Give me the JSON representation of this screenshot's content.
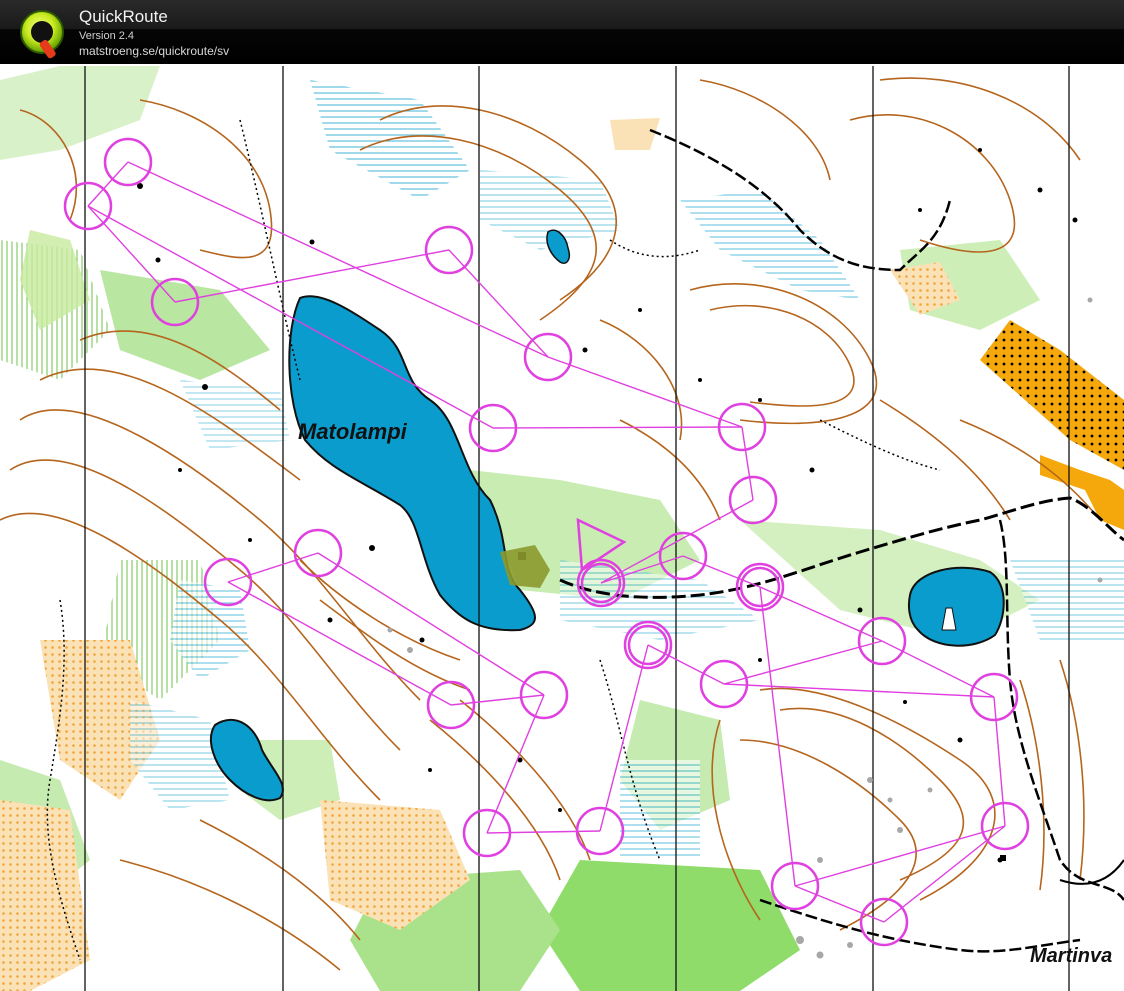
{
  "app": {
    "name": "QuickRoute",
    "version": "Version 2.4",
    "url": "matstroeng.se/quickroute/sv"
  },
  "map": {
    "labels": {
      "lake": "Matolampi",
      "martin": "Martinva"
    },
    "colors": {
      "water": "#0a9ccc",
      "water_outline": "#111111",
      "contour": "#b5651d",
      "green_light": "#c5ebb0",
      "green_medium": "#8fdc6a",
      "rough_open": "#f6c87a",
      "open_field": "#f4a80c",
      "course": "#e040e0",
      "meridian": "#111111",
      "path": "#000000"
    }
  }
}
